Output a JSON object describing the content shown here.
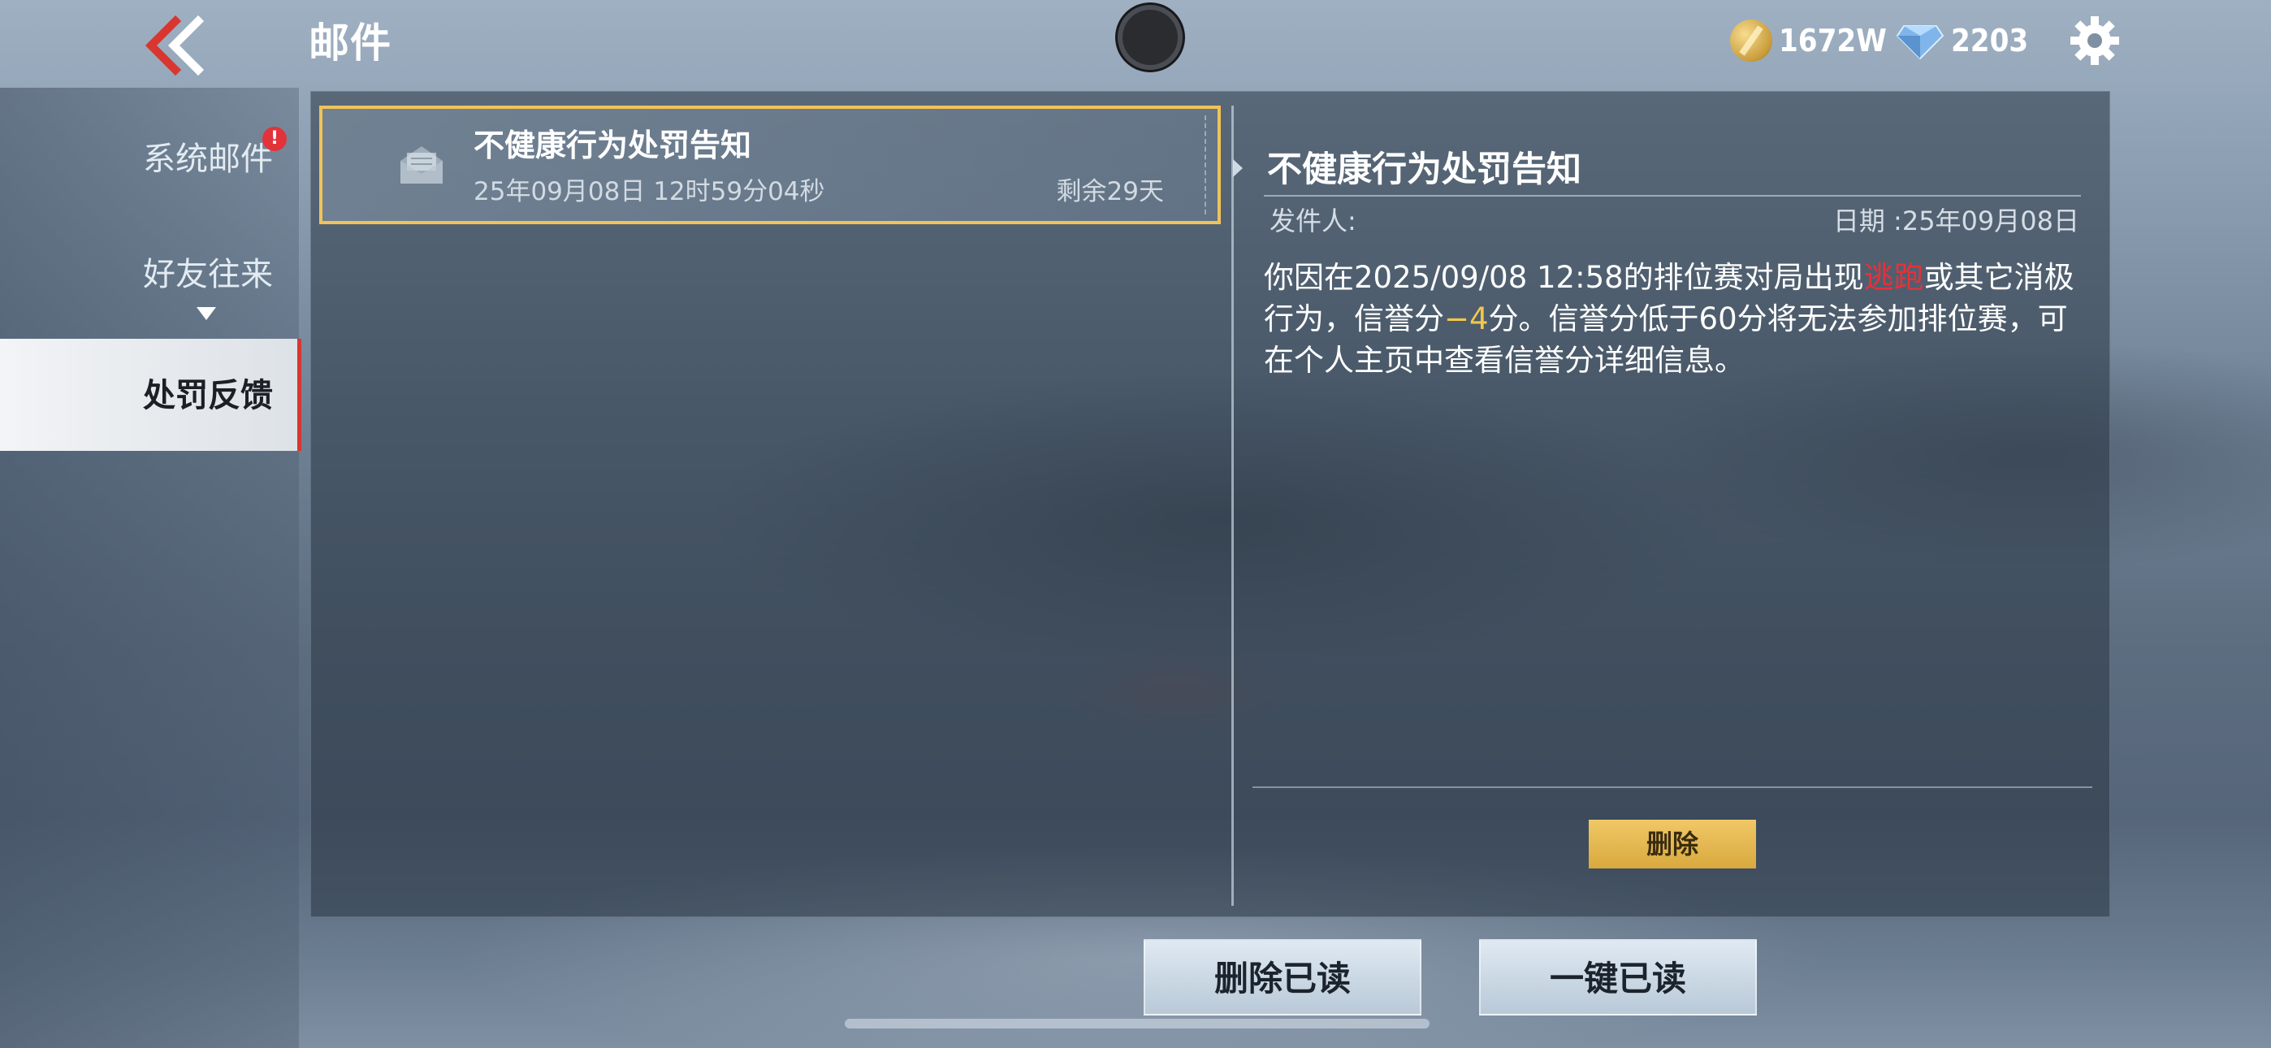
{
  "header": {
    "title": "邮件",
    "gold_amount": "1672W",
    "diamond_amount": "2203"
  },
  "sidebar": {
    "items": [
      {
        "label": "系统邮件",
        "alert": "!"
      },
      {
        "label": "好友往来"
      },
      {
        "label": "处罚反馈"
      }
    ]
  },
  "mail_list": [
    {
      "title": "不健康行为处罚告知",
      "time": "25年09月08日 12时59分04秒",
      "remaining": "剩余29天"
    }
  ],
  "detail": {
    "title": "不健康行为处罚告知",
    "sender_label": "发件人:",
    "date_label": "日期 :25年09月08日",
    "body_part1": "你因在2025/09/08 12:58的排位赛对局出现",
    "body_highlight_red": "逃跑",
    "body_part2": "或其它消极行为，信誉分",
    "body_highlight_yellow": "−4",
    "body_part3": "分。信誉分低于60分将无法参加排位赛，可在个人主页中查看信誉分详细信息。",
    "delete_label": "删除"
  },
  "footer": {
    "delete_read_label": "删除已读",
    "read_all_label": "一键已读"
  },
  "colors": {
    "accent_gold": "#f0c35a",
    "alert_red": "#e2333a",
    "active_border_red": "#d8362f",
    "text_red": "#e8303a",
    "text_yellow": "#f2c74b"
  },
  "icons": [
    "back-chevrons-icon",
    "gold-coin-icon",
    "diamond-icon",
    "gear-icon",
    "envelope-open-icon",
    "record-icon"
  ]
}
